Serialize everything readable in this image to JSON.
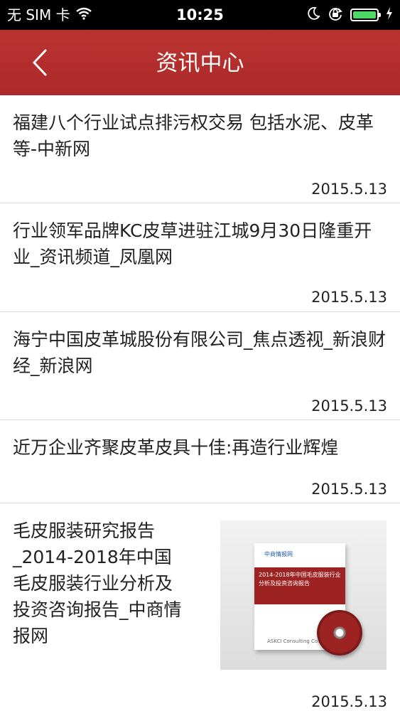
{
  "status_bar": {
    "carrier": "无 SIM 卡",
    "time": "10:25"
  },
  "nav": {
    "title": "资讯中心"
  },
  "news": [
    {
      "title": "福建八个行业试点排污权交易 包括水泥、皮革等-中新网",
      "date": "2015.5.13"
    },
    {
      "title": "行业领军品牌KC皮草进驻江城9月30日隆重开业_资讯频道_凤凰网",
      "date": "2015.5.13"
    },
    {
      "title": "海宁中国皮革城股份有限公司_焦点透视_新浪财经_新浪网",
      "date": "2015.5.13"
    },
    {
      "title": "近万企业齐聚皮革皮具十佳:再造行业辉煌",
      "date": "2015.5.13"
    },
    {
      "title": "毛皮服装研究报告_2014-2018年中国毛皮服装行业分析及投资咨询报告_中商情报网",
      "date": "2015.5.13",
      "thumbnail": {
        "brand": "中商情报网",
        "cover_text": "2014-2018年中国毛皮服装行业分析及投资咨询报告",
        "footer": "ASKCI Consulting Co., Ltd."
      }
    }
  ],
  "colors": {
    "nav_red": "#b5302d",
    "battery_green": "#4cd964"
  }
}
